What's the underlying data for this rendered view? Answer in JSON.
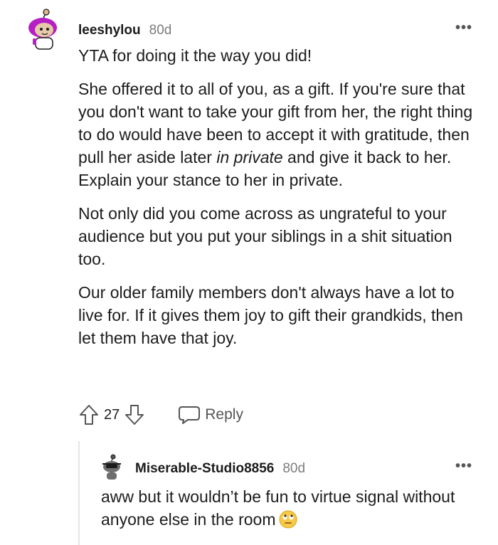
{
  "comment": {
    "username": "leeshylou",
    "age": "80d",
    "more": "•••",
    "paragraphs": [
      {
        "before": "YTA for doing it the way you did!",
        "em": "",
        "after": ""
      },
      {
        "before": "She offered it to all of you, as a gift. If you're sure that you don't want to take your gift from her, the right thing to do would have been to accept it with gratitude, then pull her aside later ",
        "em": "in private",
        "after": " and give it back to her. Explain your stance to her in private."
      },
      {
        "before": "Not only did you come across as ungrateful to your audience but you put your siblings in a shit situation too.",
        "em": "",
        "after": ""
      },
      {
        "before": "Our older family members don't always have a lot to live for. If it gives them joy to gift their grandkids, then let them have that joy.",
        "em": "",
        "after": ""
      }
    ],
    "score": "27",
    "reply_label": "Reply"
  },
  "reply": {
    "username": "Miserable-Studio8856",
    "age": "80d",
    "more": "•••",
    "text": "aww but it wouldn’t be fun to virtue signal without anyone else in the room",
    "emoji": "face-with-rolling-eyes"
  },
  "colors": {
    "text": "#1c1c1c",
    "muted": "#7c7c7c",
    "avatar_hair": "#b61fc4",
    "thread_line": "#e5e5e5"
  }
}
